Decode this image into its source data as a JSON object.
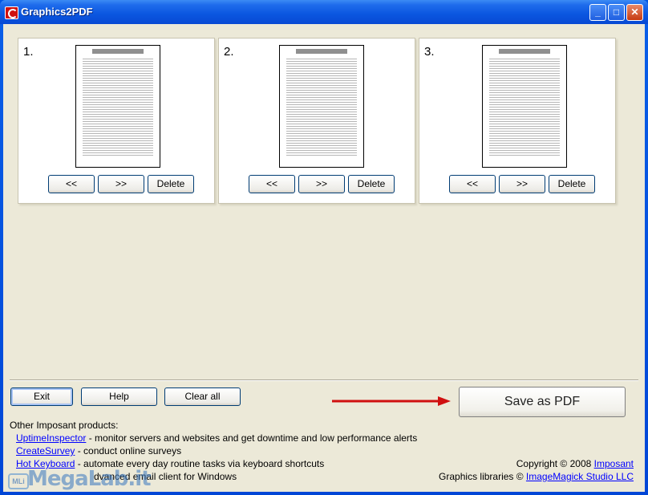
{
  "window": {
    "title": "Graphics2PDF",
    "minimize_glyph": "_",
    "maximize_glyph": "□",
    "close_glyph": "✕"
  },
  "pages": [
    {
      "number": "1.",
      "prev_label": "<<",
      "next_label": ">>",
      "delete_label": "Delete"
    },
    {
      "number": "2.",
      "prev_label": "<<",
      "next_label": ">>",
      "delete_label": "Delete"
    },
    {
      "number": "3.",
      "prev_label": "<<",
      "next_label": ">>",
      "delete_label": "Delete"
    }
  ],
  "buttons": {
    "exit": "Exit",
    "help": "Help",
    "clear_all": "Clear all",
    "save": "Save as PDF"
  },
  "products": {
    "heading": "Other Imposant products:",
    "items": [
      {
        "name": "UptimeInspector",
        "desc": " - monitor servers and websites and get downtime and low performance alerts"
      },
      {
        "name": "CreateSurvey",
        "desc": " - conduct online surveys"
      },
      {
        "name": "Hot Keyboard",
        "desc": " - automate every day routine tasks via keyboard shortcuts"
      },
      {
        "name": "",
        "desc": "dvanced email client for Windows"
      }
    ]
  },
  "footer": {
    "copyright_prefix": "Copyright © 2008 ",
    "copyright_link": "Imposant",
    "libraries_prefix": "Graphics libraries ©  ",
    "libraries_link": "ImageMagick Studio LLC"
  },
  "watermark": {
    "badge": "MLi",
    "text": "MegaLab.it"
  },
  "colors": {
    "titlebar": "#0a56e0",
    "client": "#ece9d8",
    "link": "#0000ff",
    "arrow": "#d01010"
  }
}
